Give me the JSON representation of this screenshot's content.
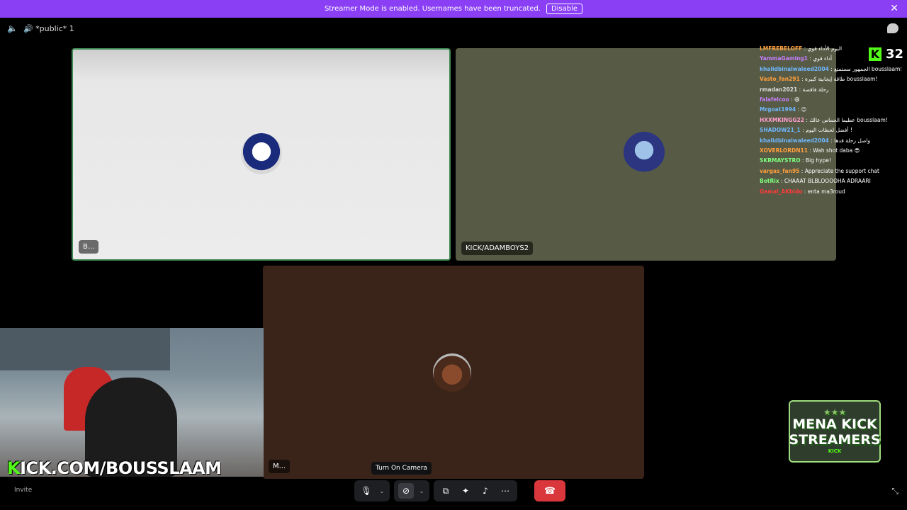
{
  "banner": {
    "text": "Streamer Mode is enabled. Usernames have been truncated.",
    "disable_label": "Disable",
    "close_glyph": "✕",
    "color": "#8a3ff5"
  },
  "channel": {
    "speaker_glyph": "🔈",
    "name": "🔊 *public* 1"
  },
  "tiles": [
    {
      "label": "B..."
    },
    {
      "label": "KICK/ADAMBOYS2"
    },
    {
      "label": "M..."
    }
  ],
  "webcam": {
    "overlay_k": "K",
    "overlay_text": "ICK.COM/BOUSSLAAM"
  },
  "invite_label": "Invite",
  "chat": [
    {
      "user": "LMFREBELOFF",
      "color": "#ff9e3d",
      "msg": " : اليوم الأداء قوي"
    },
    {
      "user": "YammaGaming1",
      "color": "#c77dff",
      "msg": " : أداء قوي"
    },
    {
      "user": "khalidbinalwaleed2004",
      "color": "#6fb7ff",
      "msg": " : الجمهور مستمتع bousslaam!"
    },
    {
      "user": "Vasto_fan291",
      "color": "#ff9e3d",
      "msg": " : طاقة إيجابية كبيرة bousslaam!"
    },
    {
      "user": "rmadan2021",
      "color": "#dddddd",
      "msg": " : رحلة فاقصة"
    },
    {
      "user": "falafelcoo",
      "color": "#c77dff",
      "msg": " : 😄"
    },
    {
      "user": "Mrgoat1994",
      "color": "#6fb7ff",
      "msg": " : 😐"
    },
    {
      "user": "HXXMKINGG22",
      "color": "#ff9ecf",
      "msg": " : عظيما الحماس عالك bousslaam!"
    },
    {
      "user": "SHADOW21_1",
      "color": "#6fb7ff",
      "msg": " : أفضل لحظات اليوم !"
    },
    {
      "user": "khalidbinalwaleed2004",
      "color": "#6fb7ff",
      "msg": " : واصل رحلة قدها"
    },
    {
      "user": "XOVERLORDN11",
      "color": "#ff9e3d",
      "msg": " : Wah shot daba 😎"
    },
    {
      "user": "SKRMAYSTRO",
      "color": "#7dff7d",
      "msg": " : Big hype!"
    },
    {
      "user": "vargas_fan95",
      "color": "#ff9e3d",
      "msg": " : Appreciate the support chat"
    },
    {
      "user": "BotRix",
      "color": "#7dff7d",
      "msg": " : CHAAAT BLBLOOOOHA ADRAARI"
    },
    {
      "user": "Gamal_AKbido",
      "color": "#ff3b3b",
      "msg": " : enta ma3roud"
    }
  ],
  "viewer_count": {
    "icon": "K",
    "count": "32"
  },
  "mena": {
    "stars": "★★★",
    "line1": "MENA KICK",
    "line2": "STREAMERS",
    "tag": "KICK"
  },
  "tooltip": "Turn On Camera",
  "controls": {
    "mic": "🎙",
    "camera": "⊘",
    "share": "⧉",
    "activities": "✦",
    "soundboard": "♪",
    "more": "⋯",
    "caret": "⌄",
    "end": "☎"
  },
  "fullscreen_glyph": "⤡",
  "colors": {
    "end_call": "#da373c",
    "kick_green": "#53fc18"
  }
}
